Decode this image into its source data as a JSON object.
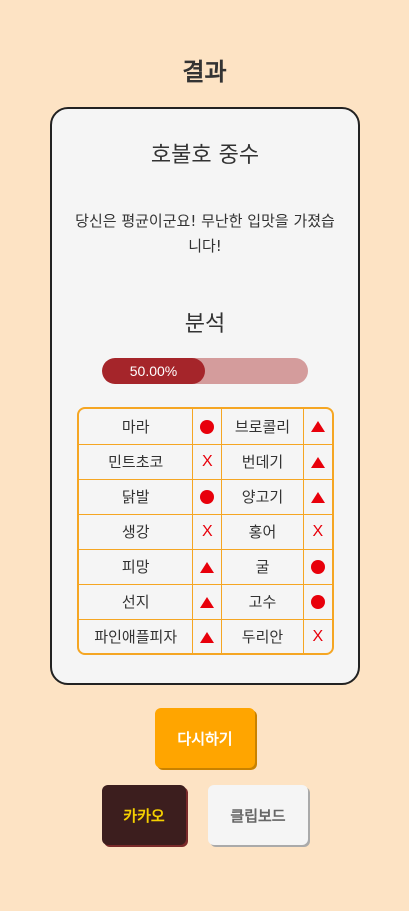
{
  "page": {
    "title": "결과"
  },
  "result": {
    "name": "호불호 중수",
    "description": "당신은 평균이군요! 무난한 입맛을 가졌습니다!"
  },
  "analysis": {
    "title": "분석",
    "progress_value": 0.5,
    "progress_label": "50.00%",
    "progress_color": "#a5252a",
    "progress_track_color": "#d49c9c"
  },
  "mark_legend": {
    "circle": "circle-icon",
    "triangle": "triangle-icon",
    "x": "X"
  },
  "foods": [
    {
      "left": "마라",
      "left_mark": "circle",
      "right": "브로콜리",
      "right_mark": "triangle"
    },
    {
      "left": "민트초코",
      "left_mark": "x",
      "right": "번데기",
      "right_mark": "triangle"
    },
    {
      "left": "닭발",
      "left_mark": "circle",
      "right": "양고기",
      "right_mark": "triangle"
    },
    {
      "left": "생강",
      "left_mark": "x",
      "right": "홍어",
      "right_mark": "x"
    },
    {
      "left": "피망",
      "left_mark": "triangle",
      "right": "굴",
      "right_mark": "circle"
    },
    {
      "left": "선지",
      "left_mark": "triangle",
      "right": "고수",
      "right_mark": "circle"
    },
    {
      "left": "파인애플피자",
      "left_mark": "triangle",
      "right": "두리안",
      "right_mark": "x"
    }
  ],
  "buttons": {
    "retry": "다시하기",
    "kakao": "카카오",
    "clipboard": "클립보드"
  },
  "colors": {
    "background": "#fde3c4",
    "accent_orange": "#ffa500",
    "mark_red": "#e8000b",
    "kakao_bg": "#3c1e1e",
    "kakao_text": "#f5d000"
  }
}
